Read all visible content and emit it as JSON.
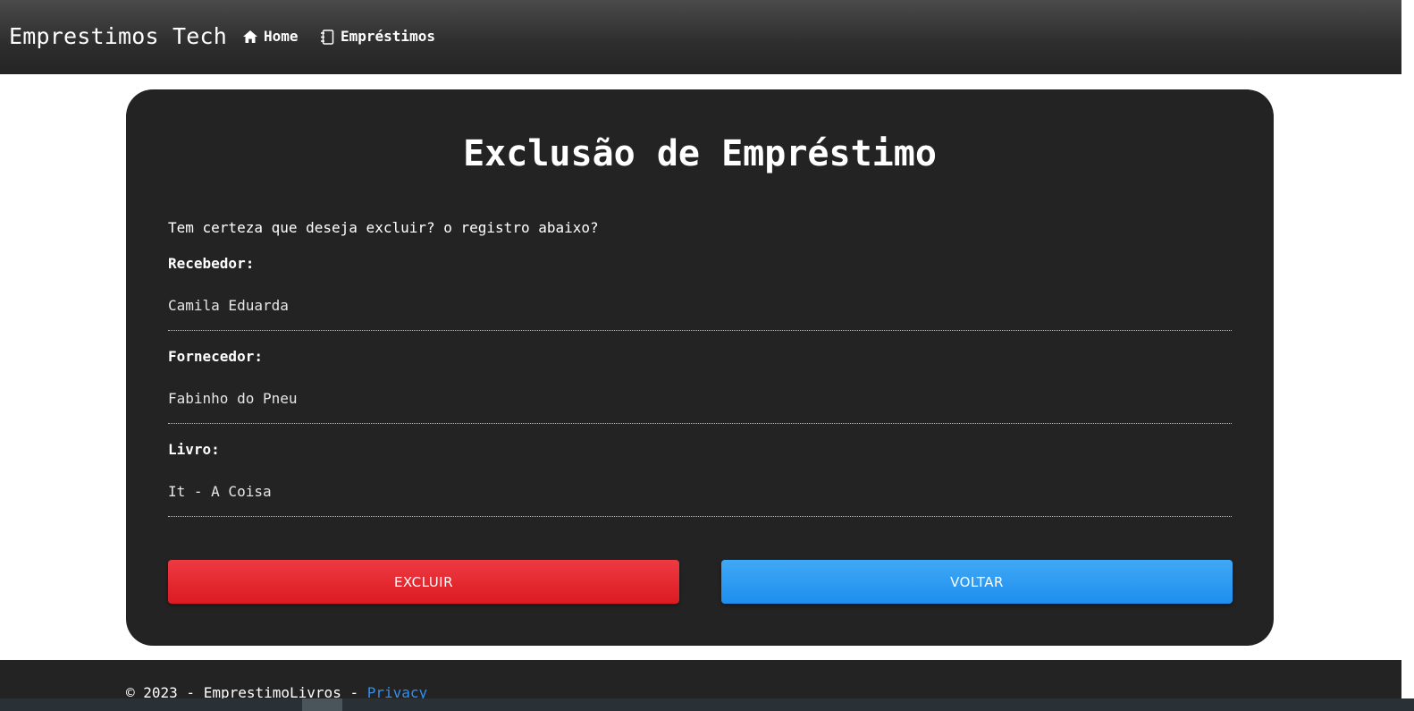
{
  "navbar": {
    "brand": "Emprestimos Tech",
    "links": [
      {
        "label": "Home",
        "icon": "home-icon"
      },
      {
        "label": "Empréstimos",
        "icon": "book-icon"
      }
    ]
  },
  "card": {
    "title": "Exclusão de Empréstimo",
    "question": "Tem certeza que deseja excluir? o registro abaixo?",
    "fields": [
      {
        "label": "Recebedor:",
        "value": "Camila Eduarda"
      },
      {
        "label": "Fornecedor:",
        "value": "Fabinho do Pneu"
      },
      {
        "label": "Livro:",
        "value": "It - A Coisa"
      }
    ],
    "buttons": {
      "delete": "EXCLUIR",
      "back": "VOLTAR"
    }
  },
  "footer": {
    "text": "© 2023 - EmprestimoLivros - ",
    "link": "Privacy"
  },
  "colors": {
    "danger": "#e52129",
    "primary": "#2a95f2",
    "card_bg": "#232323",
    "link": "#2f8ff0"
  }
}
